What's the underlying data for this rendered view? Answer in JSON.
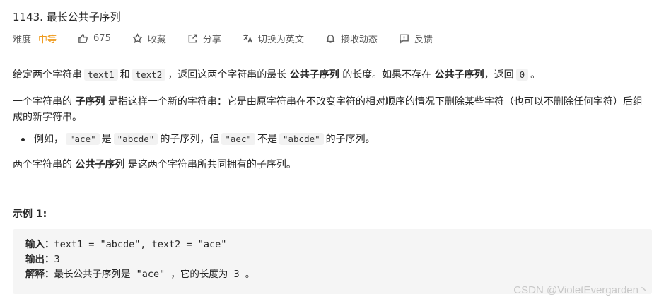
{
  "problem": {
    "title": "1143. 最长公共子序列",
    "difficulty_label": "难度",
    "difficulty": "中等",
    "likes": "675",
    "actions": {
      "favorite": "收藏",
      "share": "分享",
      "switch_lang": "切换为英文",
      "subscribe": "接收动态",
      "feedback": "反馈"
    }
  },
  "description": {
    "p1": {
      "t1": "给定两个字符串",
      "c1": "text1",
      "t2": "和",
      "c2": "text2",
      "t3": "，返回这两个字符串的最长",
      "b1": "公共子序列",
      "t4": "的长度。如果不存在",
      "b2": "公共子序列",
      "t5": "，返回",
      "c3": "0",
      "t6": "。"
    },
    "p2": {
      "t1": "一个字符串的",
      "b1": "子序列",
      "t2": "是指这样一个新的字符串：它是由原字符串在不改变字符的相对顺序的情况下删除某些字符（也可以不删除任何字符）后组成的新字符串。"
    },
    "bullet": {
      "t1": "例如，",
      "c1": "\"ace\"",
      "t2": "是",
      "c2": "\"abcde\"",
      "t3": "的子序列，但",
      "c3": "\"aec\"",
      "t4": "不是",
      "c4": "\"abcde\"",
      "t5": "的子序列。"
    },
    "p3": {
      "t1": "两个字符串的",
      "b1": "公共子序列",
      "t2": "是这两个字符串所共同拥有的子序列。"
    }
  },
  "example1": {
    "title": "示例 1:",
    "input_label": "输入：",
    "input_value": "text1 = \"abcde\", text2 = \"ace\"",
    "output_label": "输出：",
    "output_value": "3",
    "explain_label": "解释：",
    "explain_value": "最长公共子序列是 \"ace\" ，它的长度为 3 。"
  },
  "watermark": "CSDN @VioletEvergarden丶",
  "icons": [
    "thumbs-up-icon",
    "star-icon",
    "share-icon",
    "translate-icon",
    "bell-icon",
    "feedback-icon"
  ],
  "colors": {
    "difficulty_medium": "#ef9a1c",
    "code_bg": "#f2f2f2",
    "pre_bg": "#f5f5f5"
  }
}
